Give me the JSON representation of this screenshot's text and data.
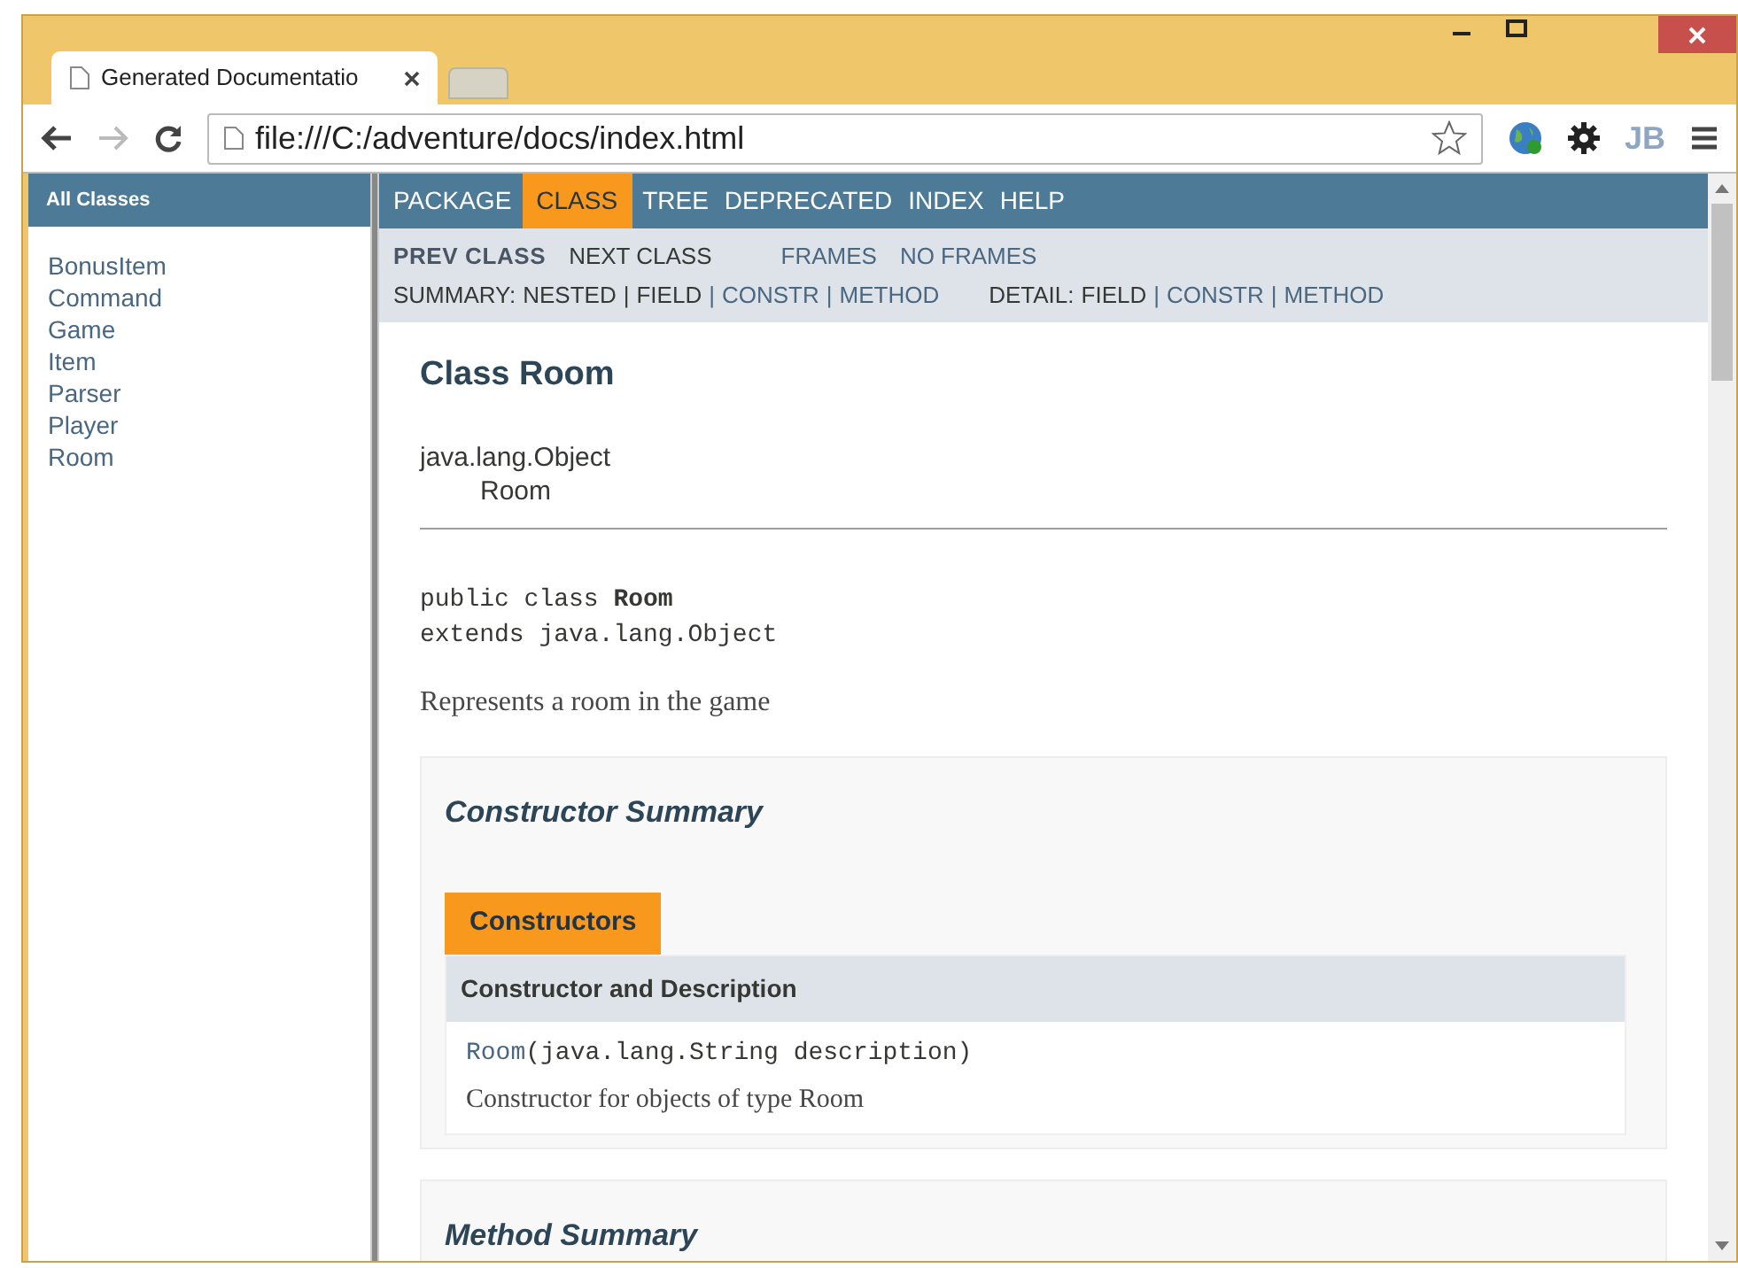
{
  "window": {
    "tab_title": "Generated Documentatio",
    "address": "file:///C:/adventure/docs/index.html",
    "extension_label": "JB"
  },
  "sidebar": {
    "title": "All Classes",
    "items": [
      "BonusItem",
      "Command",
      "Game",
      "Item",
      "Parser",
      "Player",
      "Room"
    ]
  },
  "nav": {
    "items": [
      {
        "label": "PACKAGE",
        "selected": false
      },
      {
        "label": "CLASS",
        "selected": true
      },
      {
        "label": "TREE",
        "selected": false
      },
      {
        "label": "DEPRECATED",
        "selected": false
      },
      {
        "label": "INDEX",
        "selected": false
      },
      {
        "label": "HELP",
        "selected": false
      }
    ]
  },
  "subnav": {
    "row1": [
      {
        "label": "PREV CLASS",
        "kind": "disabled"
      },
      {
        "label": "NEXT CLASS",
        "kind": "plain"
      },
      {
        "label": "FRAMES",
        "kind": "link"
      },
      {
        "label": "NO FRAMES",
        "kind": "link"
      }
    ],
    "summary": [
      {
        "label": "SUMMARY:",
        "kind": "plain"
      },
      {
        "label": "NESTED",
        "kind": "plain"
      },
      {
        "label": "|",
        "kind": "plain"
      },
      {
        "label": "FIELD",
        "kind": "plain"
      },
      {
        "label": "|",
        "kind": "link"
      },
      {
        "label": "CONSTR",
        "kind": "link"
      },
      {
        "label": "|",
        "kind": "link"
      },
      {
        "label": "METHOD",
        "kind": "link"
      }
    ],
    "detail": [
      {
        "label": "DETAIL:",
        "kind": "plain"
      },
      {
        "label": "FIELD",
        "kind": "plain"
      },
      {
        "label": "|",
        "kind": "link"
      },
      {
        "label": "CONSTR",
        "kind": "link"
      },
      {
        "label": "|",
        "kind": "link"
      },
      {
        "label": "METHOD",
        "kind": "link"
      }
    ]
  },
  "content": {
    "title": "Class Room",
    "inheritance": [
      "java.lang.Object",
      "Room"
    ],
    "signature": [
      "public class **Room**",
      "extends java.lang.Object"
    ],
    "description": "Represents a room in the game",
    "constructor_summary": {
      "heading": "Constructor Summary",
      "caption": "Constructors",
      "column": "Constructor and Description",
      "rows": [
        {
          "name": "Room",
          "params": "(java.lang.String description)",
          "description": "Constructor for objects of type Room"
        }
      ]
    },
    "method_summary": {
      "heading": "Method Summary"
    }
  }
}
